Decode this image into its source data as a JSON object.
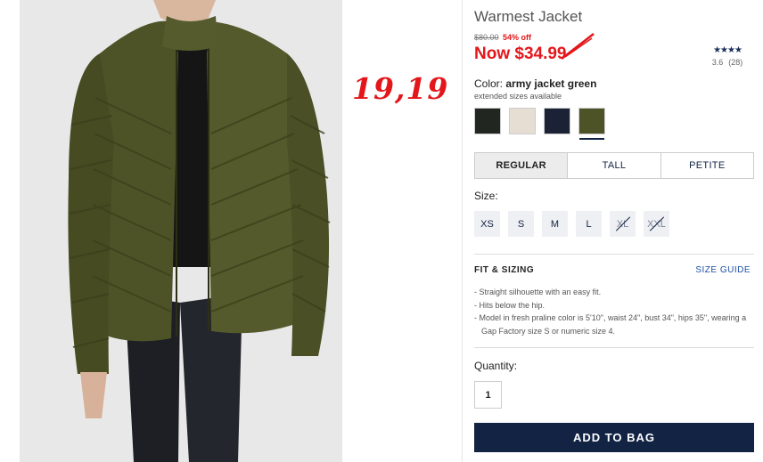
{
  "product": {
    "title": "Warmest Jacket",
    "was_price": "$80.00",
    "discount": "54% off",
    "now_price": "Now $34.99",
    "annotation": "19,19"
  },
  "rating": {
    "stars_glyph": "★★★★",
    "score": "3.6",
    "count": "(28)"
  },
  "color": {
    "label": "Color:",
    "name": "army jacket green",
    "note": "extended sizes available",
    "swatches": [
      "#222620",
      "#e6ddd3",
      "#1b2236",
      "#4e5327"
    ]
  },
  "fit_tabs": [
    "REGULAR",
    "TALL",
    "PETITE"
  ],
  "size": {
    "label": "Size:",
    "options": [
      "XS",
      "S",
      "M",
      "L",
      "XL",
      "XXL"
    ]
  },
  "fit_sizing": {
    "heading": "FIT & SIZING",
    "guide": "SIZE GUIDE",
    "bullets": [
      "- Straight silhouette with an easy fit.",
      "- Hits below the hip.",
      "- Model in fresh praline color is 5'10\", waist 24\", bust 34\", hips 35\", wearing a Gap Factory size S or numeric size 4."
    ]
  },
  "quantity": {
    "label": "Quantity:",
    "value": "1"
  },
  "cta": "ADD TO BAG",
  "colors": {
    "sale_red": "#e3171b",
    "navy": "#122344",
    "link_blue": "#1d4fa3"
  }
}
